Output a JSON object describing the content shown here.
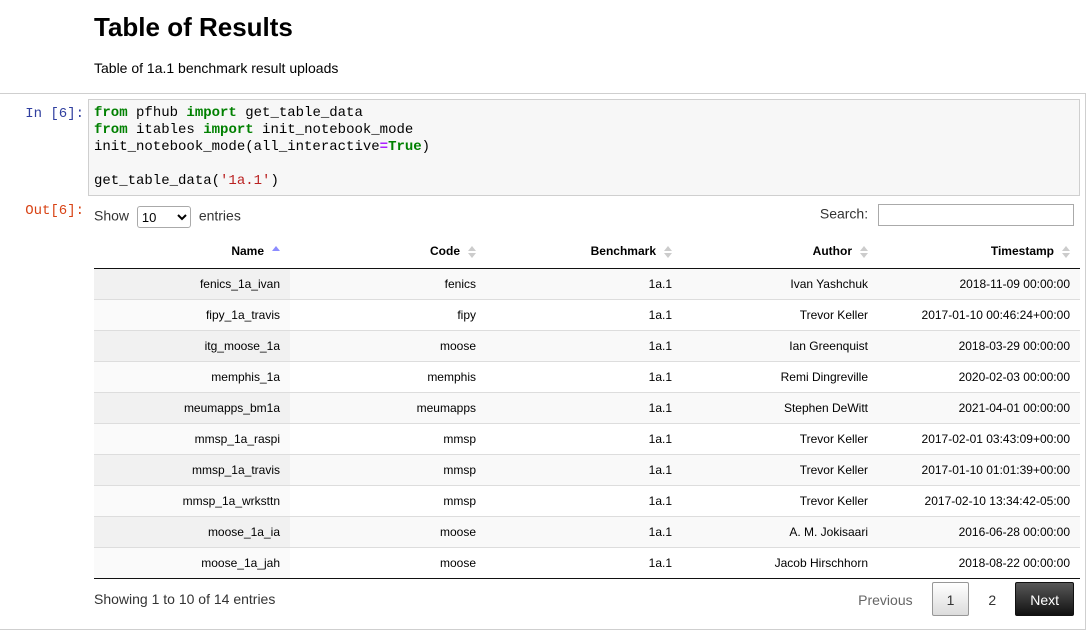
{
  "markdown": {
    "title": "Table of Results",
    "description": "Table of 1a.1 benchmark result uploads"
  },
  "cell": {
    "in_prompt": "In [6]:",
    "out_prompt": "Out[6]:",
    "code": {
      "line1_kw1": "from",
      "line1_mod": " pfhub ",
      "line1_kw2": "import",
      "line1_name": " get_table_data",
      "line2_kw1": "from",
      "line2_mod": " itables ",
      "line2_kw2": "import",
      "line2_name": " init_notebook_mode",
      "line3_call": "init_notebook_mode(all_interactive",
      "line3_op": "=",
      "line3_val": "True",
      "line3_end": ")",
      "line5_call": "get_table_data(",
      "line5_str": "'1a.1'",
      "line5_end": ")"
    }
  },
  "datatable": {
    "length_label_pre": "Show",
    "length_value": "10",
    "length_label_post": "entries",
    "search_label": "Search:",
    "search_value": "",
    "columns": [
      "Name",
      "Code",
      "Benchmark",
      "Author",
      "Timestamp"
    ],
    "rows": [
      [
        "fenics_1a_ivan",
        "fenics",
        "1a.1",
        "Ivan Yashchuk",
        "2018-11-09 00:00:00"
      ],
      [
        "fipy_1a_travis",
        "fipy",
        "1a.1",
        "Trevor Keller",
        "2017-01-10 00:46:24+00:00"
      ],
      [
        "itg_moose_1a",
        "moose",
        "1a.1",
        "Ian Greenquist",
        "2018-03-29 00:00:00"
      ],
      [
        "memphis_1a",
        "memphis",
        "1a.1",
        "Remi Dingreville",
        "2020-02-03 00:00:00"
      ],
      [
        "meumapps_bm1a",
        "meumapps",
        "1a.1",
        "Stephen DeWitt",
        "2021-04-01 00:00:00"
      ],
      [
        "mmsp_1a_raspi",
        "mmsp",
        "1a.1",
        "Trevor Keller",
        "2017-02-01 03:43:09+00:00"
      ],
      [
        "mmsp_1a_travis",
        "mmsp",
        "1a.1",
        "Trevor Keller",
        "2017-01-10 01:01:39+00:00"
      ],
      [
        "mmsp_1a_wrksttn",
        "mmsp",
        "1a.1",
        "Trevor Keller",
        "2017-02-10 13:34:42-05:00"
      ],
      [
        "moose_1a_ia",
        "moose",
        "1a.1",
        "A. M. Jokisaari",
        "2016-06-28 00:00:00"
      ],
      [
        "moose_1a_jah",
        "moose",
        "1a.1",
        "Jacob Hirschhorn",
        "2018-08-22 00:00:00"
      ]
    ],
    "info": "Showing 1 to 10 of 14 entries",
    "paging": {
      "previous": "Previous",
      "page1": "1",
      "page2": "2",
      "next": "Next"
    }
  }
}
